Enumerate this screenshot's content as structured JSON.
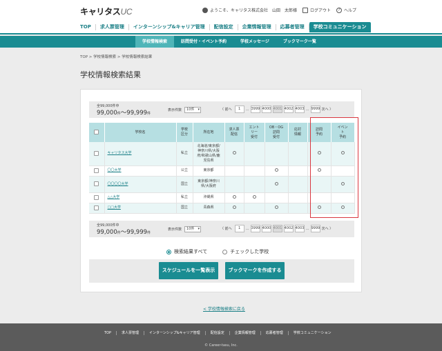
{
  "header": {
    "logo_main": "キャリタス",
    "logo_suffix": "UC",
    "greeting": "ようこそ、キャリタス株式会社　山田　太郎様",
    "logout": "ログアウト",
    "help": "ヘルプ"
  },
  "topnav": [
    {
      "label": "TOP"
    },
    {
      "label": "求人票管理"
    },
    {
      "label": "インターンシップ&キャリア管理"
    },
    {
      "label": "配信設定"
    },
    {
      "label": "企業情報管理"
    },
    {
      "label": "応募者管理"
    },
    {
      "label": "学校コミュニケーション"
    }
  ],
  "subnav": [
    {
      "label": "学校情報検索"
    },
    {
      "label": "訪問受付・イベント予約"
    },
    {
      "label": "学校メッセージ"
    },
    {
      "label": "ブックマーク一覧"
    }
  ],
  "breadcrumb": "TOP > 学校情報検索 > 学校情報検索結果",
  "page_title": "学校情報検索結果",
  "pager": {
    "total_small": "全99,000件中",
    "range_from": "99,000",
    "range_to": "99,999",
    "unit": "件",
    "tilde": "～",
    "display_label": "表示件数",
    "display_value": "10件",
    "prev": "〈 前へ",
    "next": "次へ 〉",
    "pages": [
      "1",
      "…",
      "3999",
      "4000",
      "4001",
      "4002",
      "4003",
      "…",
      "9999"
    ],
    "current_page": "4001"
  },
  "table": {
    "headers": [
      "",
      "学校名",
      "学校\n区分",
      "所在地",
      "求人票\n配信",
      "エント\nリー\n受付",
      "OB・OG\n訪問\n受付",
      "応対\n情報",
      "訪問\n予約",
      "イベン\nト\n予約"
    ],
    "rows": [
      {
        "name": "キャリタス大学",
        "type": "私立",
        "location": "北海道/東京都/\n神奈川県/大阪\n府/和歌山県/鹿\n児島県",
        "marks": [
          true,
          false,
          false,
          false,
          true,
          true
        ]
      },
      {
        "name": "〇〇大学",
        "type": "公立",
        "location": "東京都",
        "marks": [
          false,
          false,
          true,
          false,
          true,
          false
        ]
      },
      {
        "name": "〇〇〇〇大学",
        "type": "国立",
        "location": "東京都/神奈川\n県/大阪府",
        "marks": [
          false,
          false,
          true,
          false,
          false,
          true
        ]
      },
      {
        "name": "△△大学",
        "type": "私立",
        "location": "沖縄県",
        "marks": [
          true,
          true,
          false,
          false,
          false,
          false
        ]
      },
      {
        "name": "□□大学",
        "type": "国立",
        "location": "青森県",
        "marks": [
          true,
          false,
          true,
          false,
          true,
          true
        ]
      }
    ]
  },
  "radios": {
    "all": "検索結果すべて",
    "checked": "チェックした学校"
  },
  "buttons": {
    "schedule": "スケジュールを一覧表示",
    "bookmark": "ブックマークを作成する"
  },
  "back_link": "< 学校情報検索に戻る",
  "footer": {
    "links": [
      "TOP",
      "求人票管理",
      "インターンシップ&キャリア管理",
      "配信設定",
      "企業情報管理",
      "応募者管理",
      "学校コミュニケーション"
    ],
    "copyright": "© Career-tasu, Inc."
  },
  "colors": {
    "accent": "#1a8c92",
    "highlight_box": "#d9363e"
  }
}
